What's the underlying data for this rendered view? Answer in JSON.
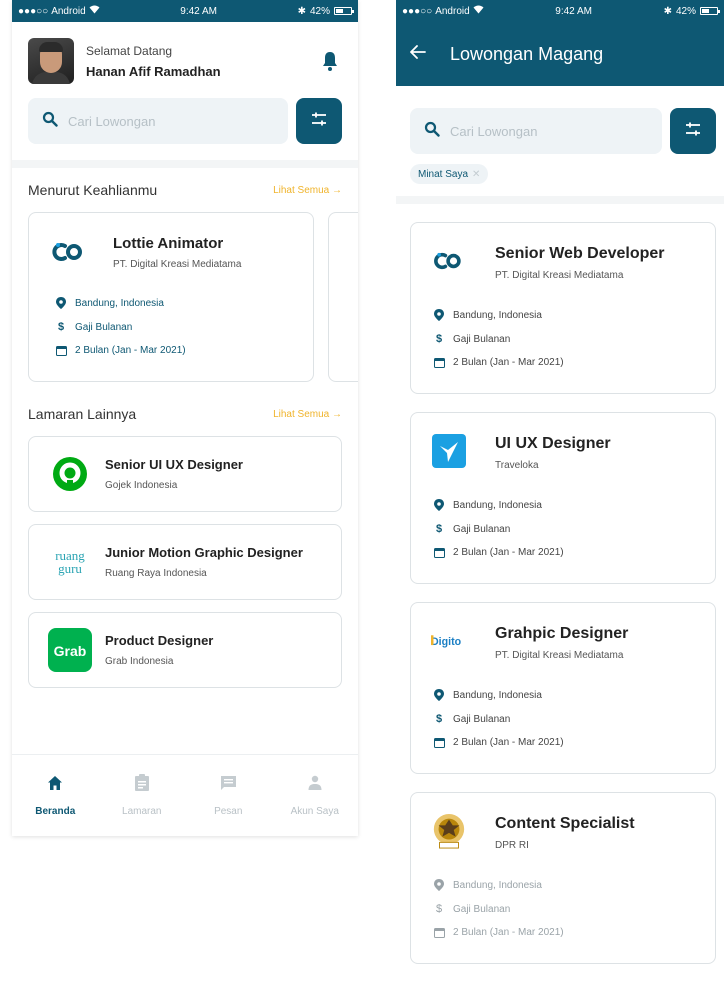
{
  "status_bar": {
    "carrier": "Android",
    "time": "9:42 AM",
    "battery": "42%"
  },
  "home": {
    "greeting": "Selamat Datang",
    "user_name": "Hanan Afif Ramadhan",
    "search_placeholder": "Cari Lowongan",
    "section1": {
      "title": "Menurut Keahlianmu",
      "see_all": "Lihat Semua →",
      "card": {
        "title": "Lottie Animator",
        "company": "PT. Digital Kreasi Mediatama",
        "location": "Bandung, Indonesia",
        "salary": "Gaji Bulanan",
        "duration": "2 Bulan (Jan - Mar 2021)",
        "logo": "co-logo"
      }
    },
    "section2": {
      "title": "Lamaran Lainnya",
      "see_all": "Lihat Semua →",
      "items": [
        {
          "title": "Senior UI UX Designer",
          "company": "Gojek Indonesia",
          "logo": "gojek-logo"
        },
        {
          "title": "Junior Motion Graphic Designer",
          "company": "Ruang Raya Indonesia",
          "logo": "ruangguru-logo",
          "logo_text": "ruang\nguru"
        },
        {
          "title": "Product Designer",
          "company": "Grab Indonesia",
          "logo": "grab-logo",
          "logo_text": "Grab"
        }
      ]
    },
    "nav": [
      {
        "label": "Beranda",
        "icon": "home-icon",
        "active": true
      },
      {
        "label": "Lamaran",
        "icon": "clipboard-icon",
        "active": false
      },
      {
        "label": "Pesan",
        "icon": "message-icon",
        "active": false
      },
      {
        "label": "Akun Saya",
        "icon": "person-icon",
        "active": false
      }
    ]
  },
  "listing": {
    "title": "Lowongan Magang",
    "search_placeholder": "Cari Lowongan",
    "chip": "Minat Saya",
    "jobs": [
      {
        "title": "Senior Web Developer",
        "company": "PT. Digital Kreasi Mediatama",
        "location": "Bandung, Indonesia",
        "salary": "Gaji Bulanan",
        "duration": "2 Bulan (Jan - Mar 2021)",
        "logo": "co-logo"
      },
      {
        "title": "UI UX Designer",
        "company": "Traveloka",
        "location": "Bandung, Indonesia",
        "salary": "Gaji Bulanan",
        "duration": "2 Bulan (Jan - Mar 2021)",
        "logo": "traveloka-logo"
      },
      {
        "title": "Grahpic Designer",
        "company": "PT. Digital Kreasi Mediatama",
        "location": "Bandung, Indonesia",
        "salary": "Gaji Bulanan",
        "duration": "2 Bulan (Jan - Mar 2021)",
        "logo": "digito-logo",
        "logo_text": "Digito"
      },
      {
        "title": "Content Specialist",
        "company": "DPR RI",
        "location": "Bandung, Indonesia",
        "salary": "Gaji Bulanan",
        "duration": "2 Bulan (Jan - Mar 2021)",
        "logo": "dpr-emblem"
      }
    ]
  },
  "colors": {
    "primary": "#0e5873",
    "accent": "#f0b42c",
    "gojek": "#00aa13",
    "grab": "#00b14f",
    "traveloka": "#1ba0e2"
  }
}
